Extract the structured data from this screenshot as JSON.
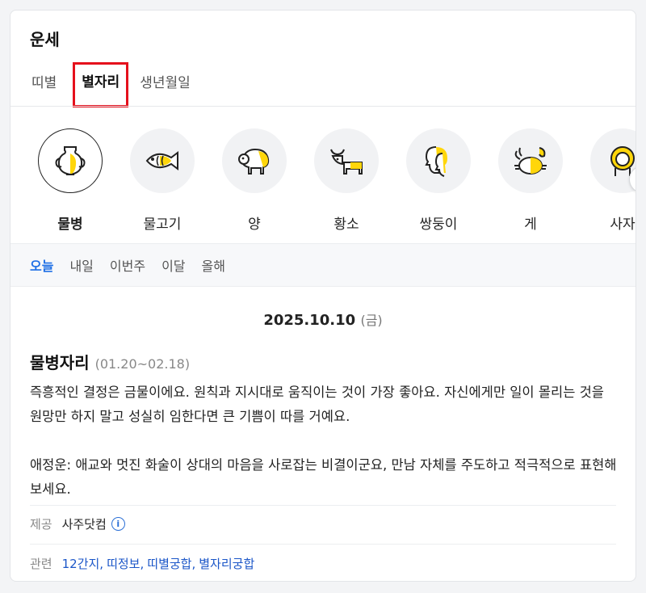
{
  "card": {
    "title": "운세"
  },
  "tabs": [
    "띠별",
    "별자리",
    "생년월일"
  ],
  "zodiac": [
    {
      "label": "물병",
      "icon": "aquarius-vase-icon"
    },
    {
      "label": "물고기",
      "icon": "pisces-fish-icon"
    },
    {
      "label": "양",
      "icon": "aries-ram-icon"
    },
    {
      "label": "황소",
      "icon": "taurus-bull-icon"
    },
    {
      "label": "쌍둥이",
      "icon": "gemini-twins-icon"
    },
    {
      "label": "게",
      "icon": "cancer-crab-icon"
    },
    {
      "label": "사자",
      "icon": "leo-lion-icon"
    }
  ],
  "periods": [
    "오늘",
    "내일",
    "이번주",
    "이달",
    "올해"
  ],
  "date": {
    "value": "2025.10.10",
    "dow": "(금)"
  },
  "sign": {
    "name": "물병자리",
    "range": "(01.20~02.18)"
  },
  "fortune": {
    "para1": "즉흥적인 결정은 금물이에요. 원칙과 지시대로 움직이는 것이 가장 좋아요. 자신에게만 일이 몰리는 것을 원망만 하지 말고 성실히 임한다면 큰 기쁨이 따를 거예요.",
    "para2": "애정운: 애교와 멋진 화술이 상대의 마음을 사로잡는 비결이군요, 만남 자체를 주도하고 적극적으로 표현해 보세요."
  },
  "source": {
    "label": "제공",
    "value": "사주닷컴",
    "info_icon": "i"
  },
  "related": {
    "label": "관련",
    "links": [
      "12간지",
      "띠정보",
      "띠별궁합",
      "별자리궁합"
    ]
  },
  "colors": {
    "accent_yellow": "#ffd60a",
    "active_blue": "#1f6fe5",
    "highlight_red": "#e5101c"
  }
}
